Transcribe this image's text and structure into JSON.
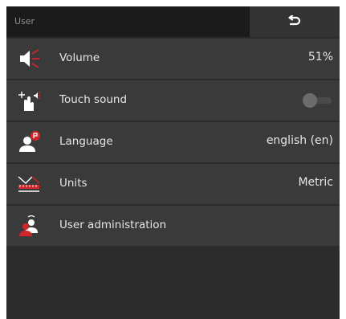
{
  "header": {
    "title": "User"
  },
  "settings": {
    "volume": {
      "label": "Volume",
      "value": "51%",
      "icon": "speaker-icon"
    },
    "touch_sound": {
      "label": "Touch sound",
      "icon": "touch-sound-icon",
      "enabled": false
    },
    "language": {
      "label": "Language",
      "value": "english (en)",
      "icon": "person-language-icon"
    },
    "units": {
      "label": "Units",
      "value": "Metric",
      "icon": "units-icon"
    },
    "user_admin": {
      "label": "User administration",
      "icon": "user-admin-icon"
    }
  },
  "colors": {
    "accent": "#d2262b",
    "background": "#2b2b2b",
    "row": "#3a3a3a"
  }
}
